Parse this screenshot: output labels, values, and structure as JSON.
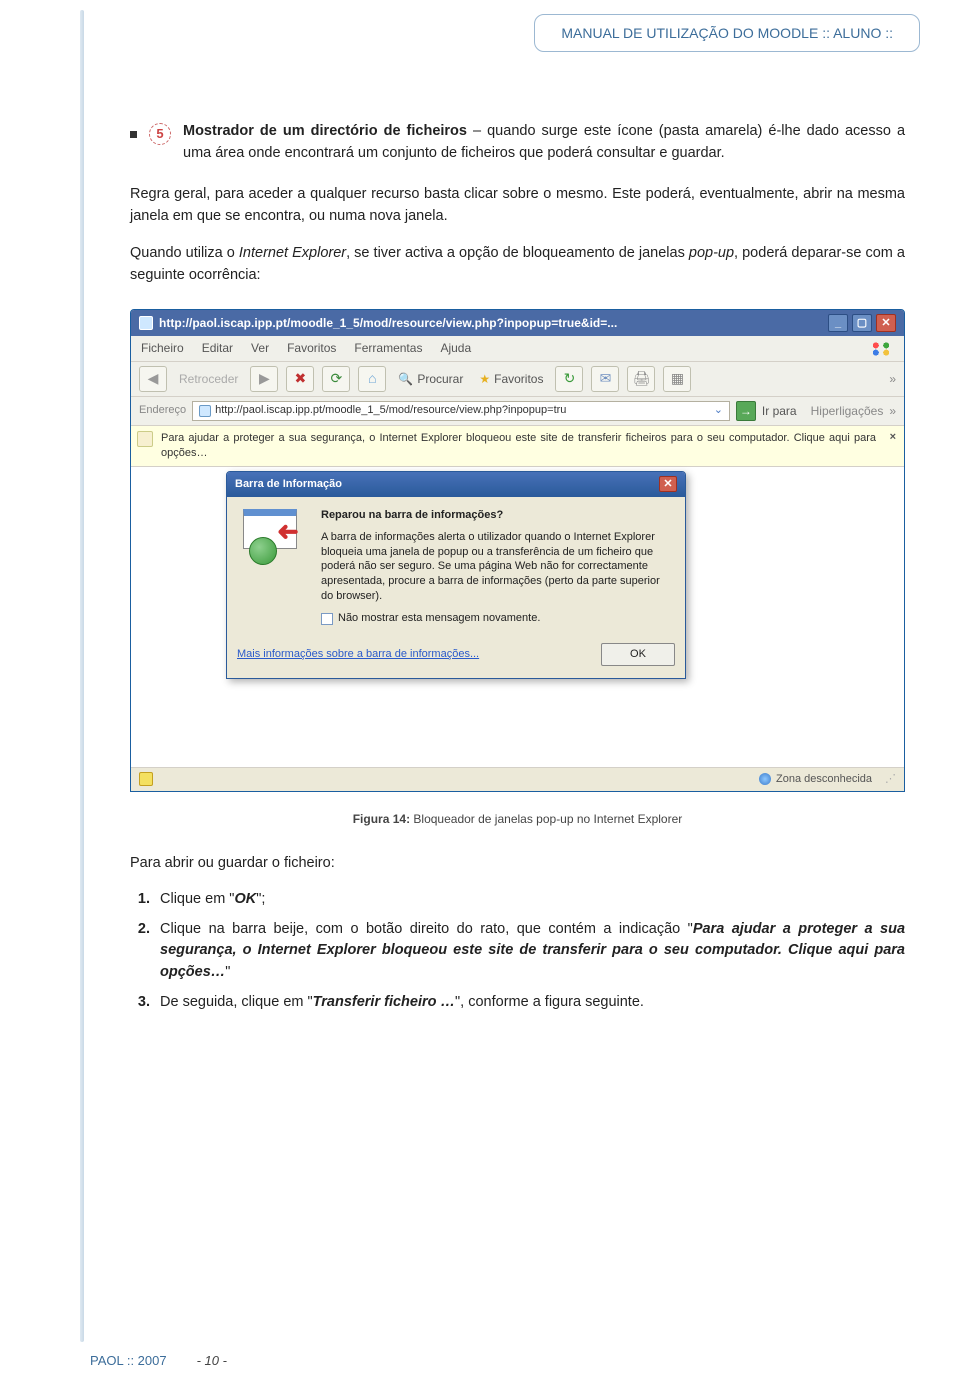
{
  "header": "MANUAL DE UTILIZAÇÃO DO MOODLE  :: ALUNO ::",
  "bullet": {
    "num": "5",
    "lead": "Mostrador de um directório de ficheiros",
    "rest": " – quando surge este ícone (pasta amarela) é-lhe dado acesso a uma área onde encontrará um conjunto de ficheiros que poderá consultar e guardar."
  },
  "para1": "Regra geral, para aceder a qualquer recurso basta clicar sobre o mesmo. Este poderá, eventualmente, abrir na mesma janela em que se encontra, ou numa nova janela.",
  "para2a": "Quando utiliza o ",
  "para2b": "Internet Explorer",
  "para2c": ", se tiver activa a opção de bloqueamento de janelas ",
  "para2d": "pop-up",
  "para2e": ", poderá deparar-se com a seguinte ocorrência:",
  "ie": {
    "title": "http://paol.iscap.ipp.pt/moodle_1_5/mod/resource/view.php?inpopup=true&id=... ",
    "menu": [
      "Ficheiro",
      "Editar",
      "Ver",
      "Favoritos",
      "Ferramentas",
      "Ajuda"
    ],
    "back": "Retroceder",
    "search": "Procurar",
    "fav": "Favoritos",
    "addrLabel": "Endereço",
    "addr": "http://paol.iscap.ipp.pt/moodle_1_5/mod/resource/view.php?inpopup=tru",
    "go": "Ir para",
    "links": "Hiperligações",
    "infobar": "Para ajudar a proteger a sua segurança, o Internet Explorer bloqueou este site de transferir ficheiros para o seu computador. Clique aqui para opções…",
    "dlg": {
      "title": "Barra de Informação",
      "h": "Reparou na barra de informações?",
      "body": "A barra de informações alerta o utilizador quando o Internet Explorer bloqueia uma janela de popup ou a transferência de um ficheiro que poderá não ser seguro. Se uma página Web não for correctamente apresentada, procure a barra de informações (perto da parte superior do browser).",
      "chk": "Não mostrar esta mensagem novamente.",
      "link": "Mais informações sobre a barra de informações...",
      "ok": "OK"
    },
    "zone": "Zona desconhecida"
  },
  "caption_lead": "Figura 14: ",
  "caption_rest": "Bloqueador de janelas pop-up no Internet Explorer",
  "subheading": "Para abrir ou guardar o ficheiro:",
  "steps": {
    "s1a": "Clique em \"",
    "s1b": "OK",
    "s1c": "\";",
    "s2a": "Clique na barra beije, com o botão direito do rato, que contém a indicação \"",
    "s2b": "Para ajudar a proteger a sua segurança, o Internet Explorer bloqueou este site de transferir para o seu computador. Clique aqui para opções…",
    "s2c": "\"",
    "s3a": "De seguida, clique em \"",
    "s3b": "Transferir ficheiro …",
    "s3c": "\", conforme a figura seguinte."
  },
  "footer": {
    "left": "PAOL :: 2007",
    "page": "- 10 -"
  }
}
